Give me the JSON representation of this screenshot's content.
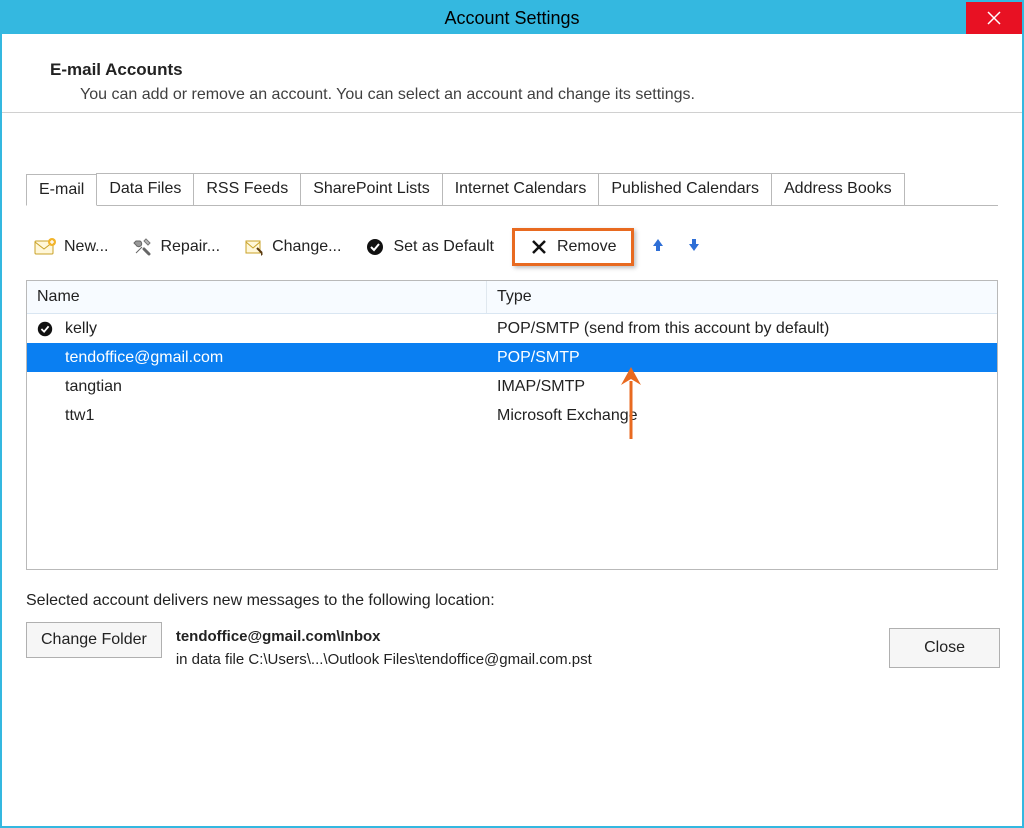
{
  "window": {
    "title": "Account Settings",
    "close_icon": "close"
  },
  "header": {
    "title": "E-mail Accounts",
    "description": "You can add or remove an account. You can select an account and change its settings."
  },
  "tabs": [
    {
      "label": "E-mail",
      "active": true
    },
    {
      "label": "Data Files",
      "active": false
    },
    {
      "label": "RSS Feeds",
      "active": false
    },
    {
      "label": "SharePoint Lists",
      "active": false
    },
    {
      "label": "Internet Calendars",
      "active": false
    },
    {
      "label": "Published Calendars",
      "active": false
    },
    {
      "label": "Address Books",
      "active": false
    }
  ],
  "toolbar": {
    "new_label": "New...",
    "repair_label": "Repair...",
    "change_label": "Change...",
    "default_label": "Set as Default",
    "remove_label": "Remove"
  },
  "columns": {
    "name": "Name",
    "type": "Type"
  },
  "accounts": [
    {
      "name": "kelly",
      "type": "POP/SMTP (send from this account by default)",
      "default": true,
      "selected": false
    },
    {
      "name": "tendoffice@gmail.com",
      "type": "POP/SMTP",
      "default": false,
      "selected": true
    },
    {
      "name": "tangtian",
      "type": "IMAP/SMTP",
      "default": false,
      "selected": false
    },
    {
      "name": "ttw1",
      "type": "Microsoft Exchange",
      "default": false,
      "selected": false
    }
  ],
  "delivery": {
    "message": "Selected account delivers new messages to the following location:",
    "change_folder_label": "Change Folder",
    "location_strong": "tendoffice@gmail.com\\Inbox",
    "location_path": "in data file C:\\Users\\...\\Outlook Files\\tendoffice@gmail.com.pst"
  },
  "footer": {
    "close_label": "Close"
  }
}
